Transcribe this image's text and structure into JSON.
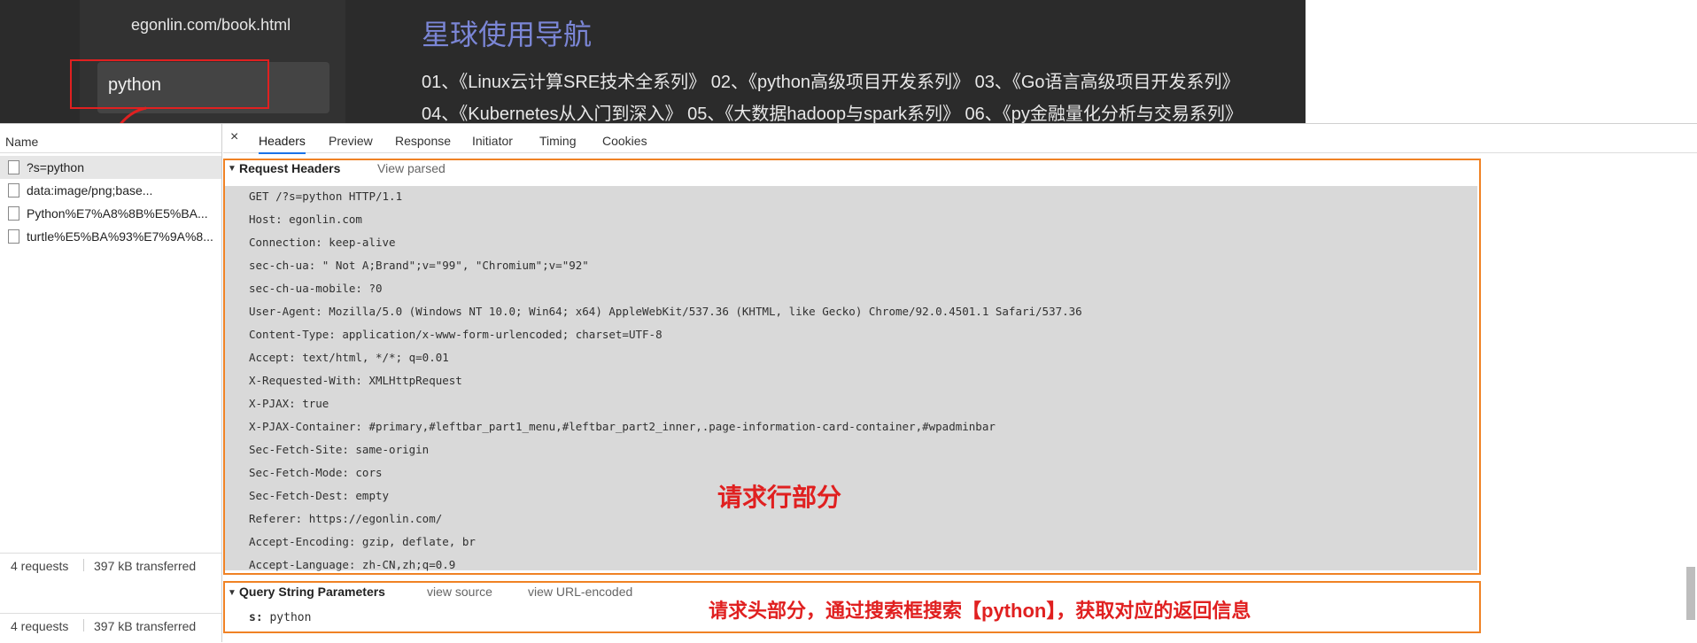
{
  "site": {
    "url": "egonlin.com/book.html",
    "search_value": "python",
    "nav_title": "星球使用导航",
    "nav_line1": "01、《Linux云计算SRE技术全系列》 02、《python高级项目开发系列》 03、《Go语言高级项目开发系列》",
    "nav_line2": "04、《Kubernetes从入门到深入》 05、《大数据hadoop与spark系列》 06、《py金融量化分析与交易系列》"
  },
  "devtools": {
    "name_header": "Name",
    "requests": [
      "?s=python",
      "data:image/png;base...",
      "Python%E7%A8%8B%E5%BA...",
      "turtle%E5%BA%93%E7%9A%8..."
    ],
    "status": {
      "count": "4 requests",
      "transferred": "397 kB transferred"
    },
    "close": "×",
    "tabs": [
      "Headers",
      "Preview",
      "Response",
      "Initiator",
      "Timing",
      "Cookies"
    ],
    "request_headers_title": "Request Headers",
    "view_parsed": "View parsed",
    "header_lines": [
      "GET /?s=python HTTP/1.1",
      "Host: egonlin.com",
      "Connection: keep-alive",
      "sec-ch-ua: \" Not A;Brand\";v=\"99\", \"Chromium\";v=\"92\"",
      "sec-ch-ua-mobile: ?0",
      "User-Agent: Mozilla/5.0 (Windows NT 10.0; Win64; x64) AppleWebKit/537.36 (KHTML, like Gecko) Chrome/92.0.4501.1 Safari/537.36",
      "Content-Type: application/x-www-form-urlencoded; charset=UTF-8",
      "Accept: text/html, */*; q=0.01",
      "X-Requested-With: XMLHttpRequest",
      "X-PJAX: true",
      "X-PJAX-Container: #primary,#leftbar_part1_menu,#leftbar_part2_inner,.page-information-card-container,#wpadminbar",
      "Sec-Fetch-Site: same-origin",
      "Sec-Fetch-Mode: cors",
      "Sec-Fetch-Dest: empty",
      "Referer: https://egonlin.com/",
      "Accept-Encoding: gzip, deflate, br",
      "Accept-Language: zh-CN,zh;q=0.9"
    ],
    "query_string_title": "Query String Parameters",
    "view_source": "view source",
    "view_url_encoded": "view URL-encoded",
    "param_key": "s:",
    "param_value": "python"
  },
  "annotations": {
    "request_line_label": "请求行部分",
    "request_header_label": "请求头部分，通过搜索框搜索【python】，获取对应的返回信息"
  },
  "colors": {
    "annotation_red": "#e02020",
    "highlight_orange": "#f08224",
    "nav_title_blue": "#7b86d6"
  }
}
